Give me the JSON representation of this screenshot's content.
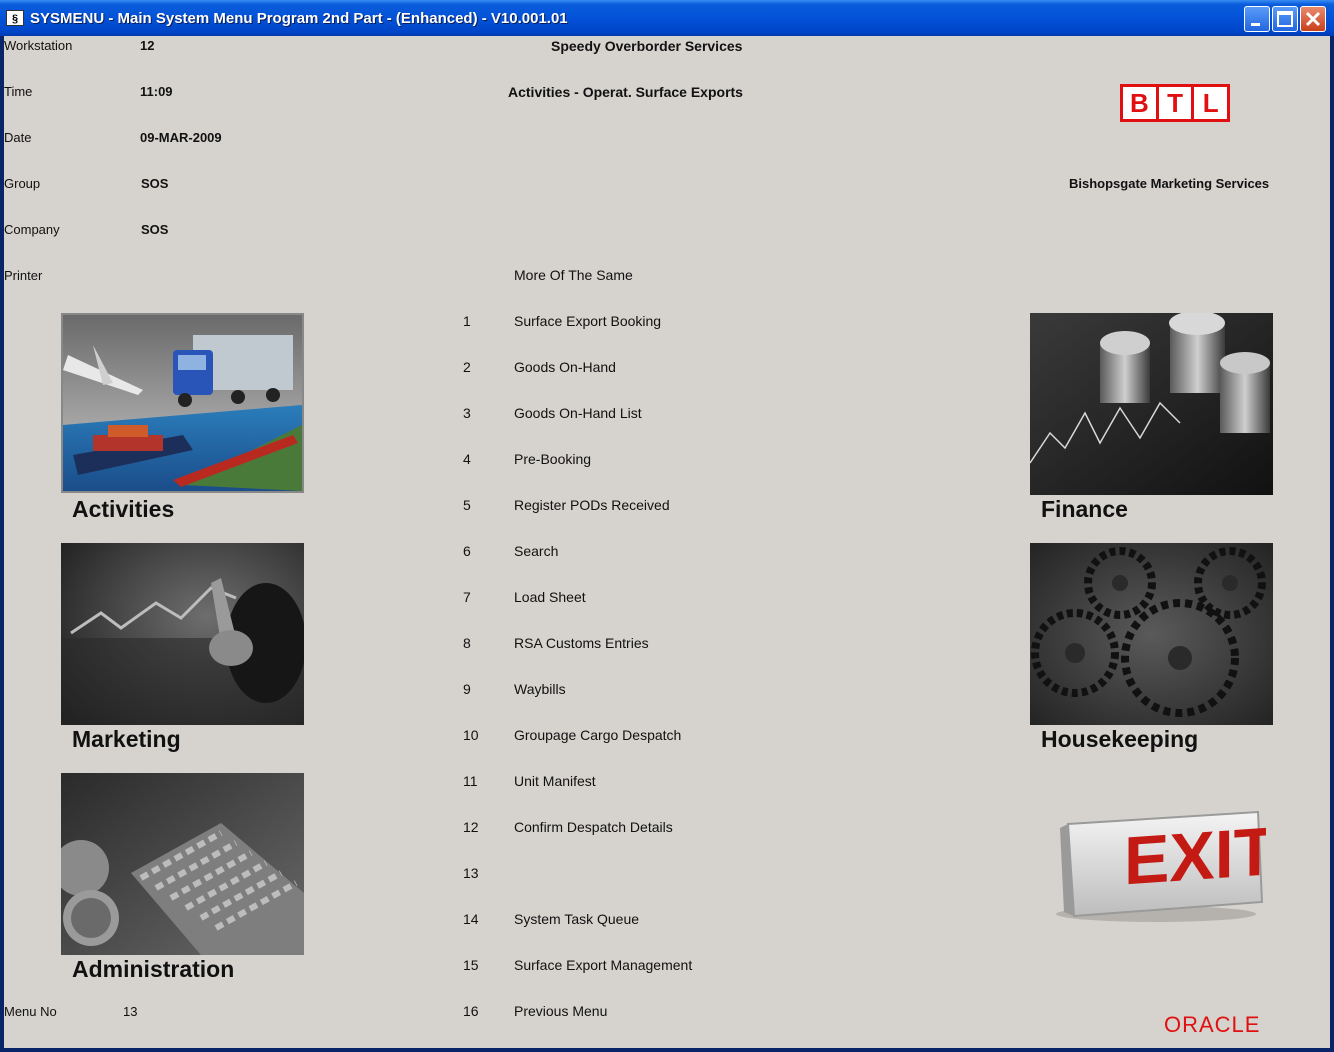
{
  "window": {
    "icon": "app-window-icon",
    "title": "SYSMENU - Main System Menu Program 2nd Part - (Enhanced) - V10.001.01"
  },
  "info": {
    "workstation_label": "Workstation",
    "workstation_value": "12",
    "time_label": "Time",
    "time_value": "11:09",
    "date_label": "Date",
    "date_value": "09-MAR-2009",
    "group_label": "Group",
    "group_value": "SOS",
    "company_label": "Company",
    "company_value": "SOS",
    "printer_label": "Printer",
    "menuno_label": "Menu No",
    "menuno_value": "13"
  },
  "header": {
    "company_name": "Speedy Overborder Services",
    "subtitle": "Activities - Operat. Surface Exports",
    "right_company": "Bishopsgate Marketing Services",
    "logo_letters": [
      "B",
      "T",
      "L"
    ],
    "menu_heading": "More Of The Same"
  },
  "menu": [
    {
      "num": "1",
      "label": "Surface Export Booking"
    },
    {
      "num": "2",
      "label": "Goods On-Hand"
    },
    {
      "num": "3",
      "label": "Goods On-Hand List"
    },
    {
      "num": "4",
      "label": "Pre-Booking"
    },
    {
      "num": "5",
      "label": "Register PODs Received"
    },
    {
      "num": "6",
      "label": "Search"
    },
    {
      "num": "7",
      "label": "Load Sheet"
    },
    {
      "num": "8",
      "label": "RSA Customs Entries"
    },
    {
      "num": "9",
      "label": "Waybills"
    },
    {
      "num": "10",
      "label": "Groupage Cargo Despatch"
    },
    {
      "num": "11",
      "label": "Unit Manifest"
    },
    {
      "num": "12",
      "label": "Confirm Despatch Details"
    },
    {
      "num": "13",
      "label": ""
    },
    {
      "num": "14",
      "label": "System Task Queue"
    },
    {
      "num": "15",
      "label": "Surface Export Management"
    },
    {
      "num": "16",
      "label": "Previous Menu"
    }
  ],
  "tiles": {
    "activities": "Activities",
    "marketing": "Marketing",
    "administration": "Administration",
    "finance": "Finance",
    "housekeeping": "Housekeeping"
  },
  "exit_sign": "EXIT",
  "oracle_logo": "ORACLE",
  "colors": {
    "titlebar": "#0352d8",
    "background": "#d6d3ce",
    "brand_red": "#e01010"
  }
}
